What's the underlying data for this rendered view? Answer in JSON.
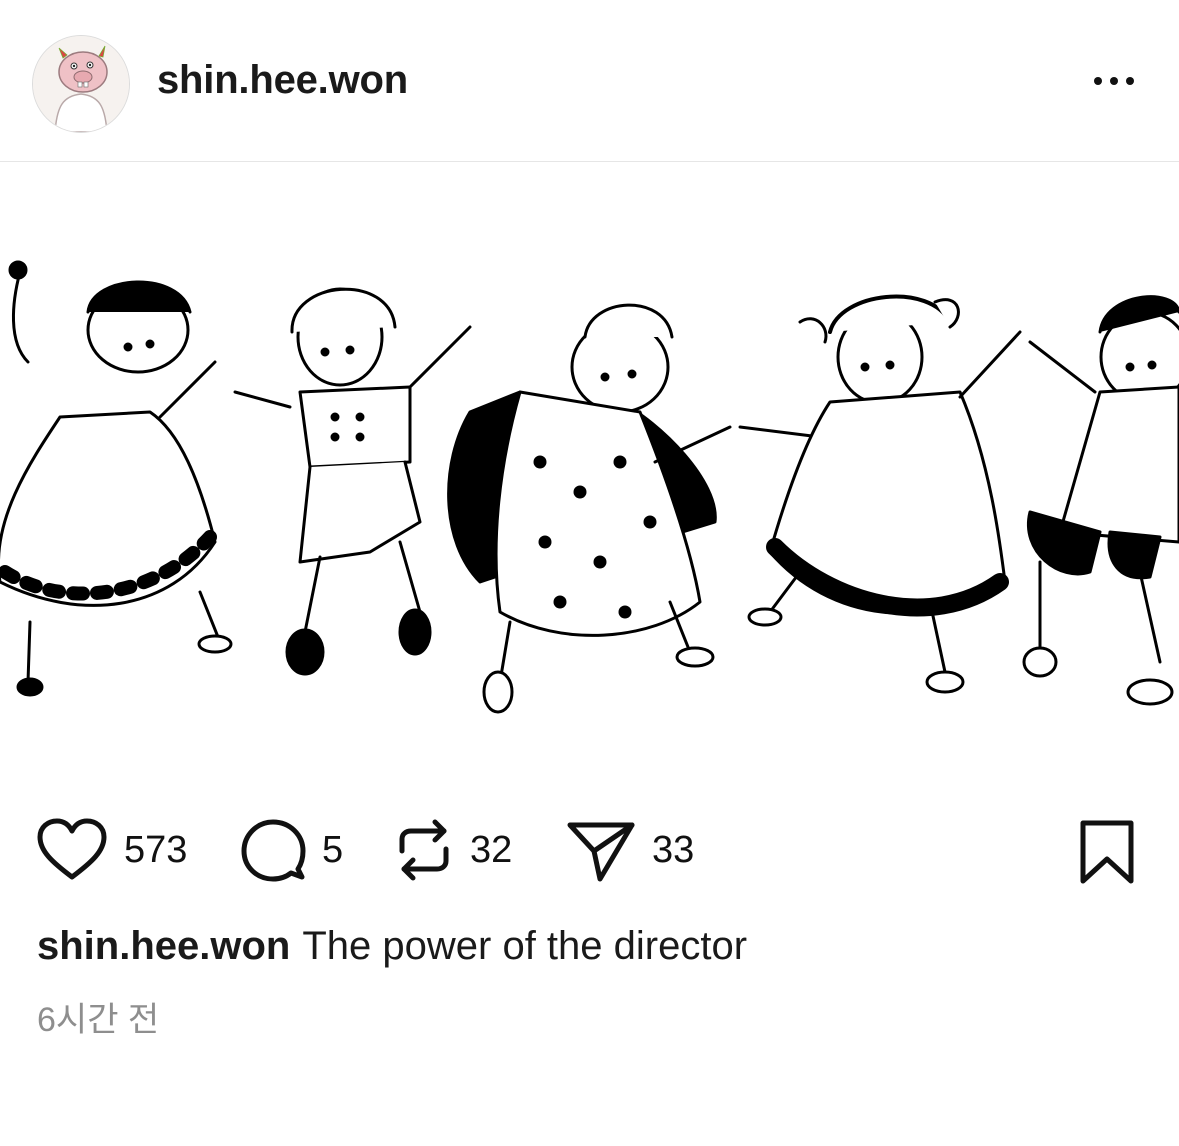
{
  "header": {
    "username": "shin.hee.won",
    "avatar_icon": "cartoon-creature-avatar",
    "more_icon": "more-horizontal-icon"
  },
  "post": {
    "image_description": "",
    "stats": {
      "likes": "573",
      "comments": "5",
      "reposts": "32",
      "shares": "33"
    },
    "icons": {
      "like": "heart-icon",
      "comment": "comment-bubble-icon",
      "repost": "repost-icon",
      "share": "send-icon",
      "bookmark": "bookmark-icon"
    },
    "caption": {
      "username": "shin.hee.won",
      "text": "The power of the director"
    },
    "timestamp": "6시간 전"
  },
  "colors": {
    "text": "#1a1a1a",
    "muted": "#8e8e8e",
    "divider": "#e6e6e6",
    "background": "#ffffff"
  }
}
